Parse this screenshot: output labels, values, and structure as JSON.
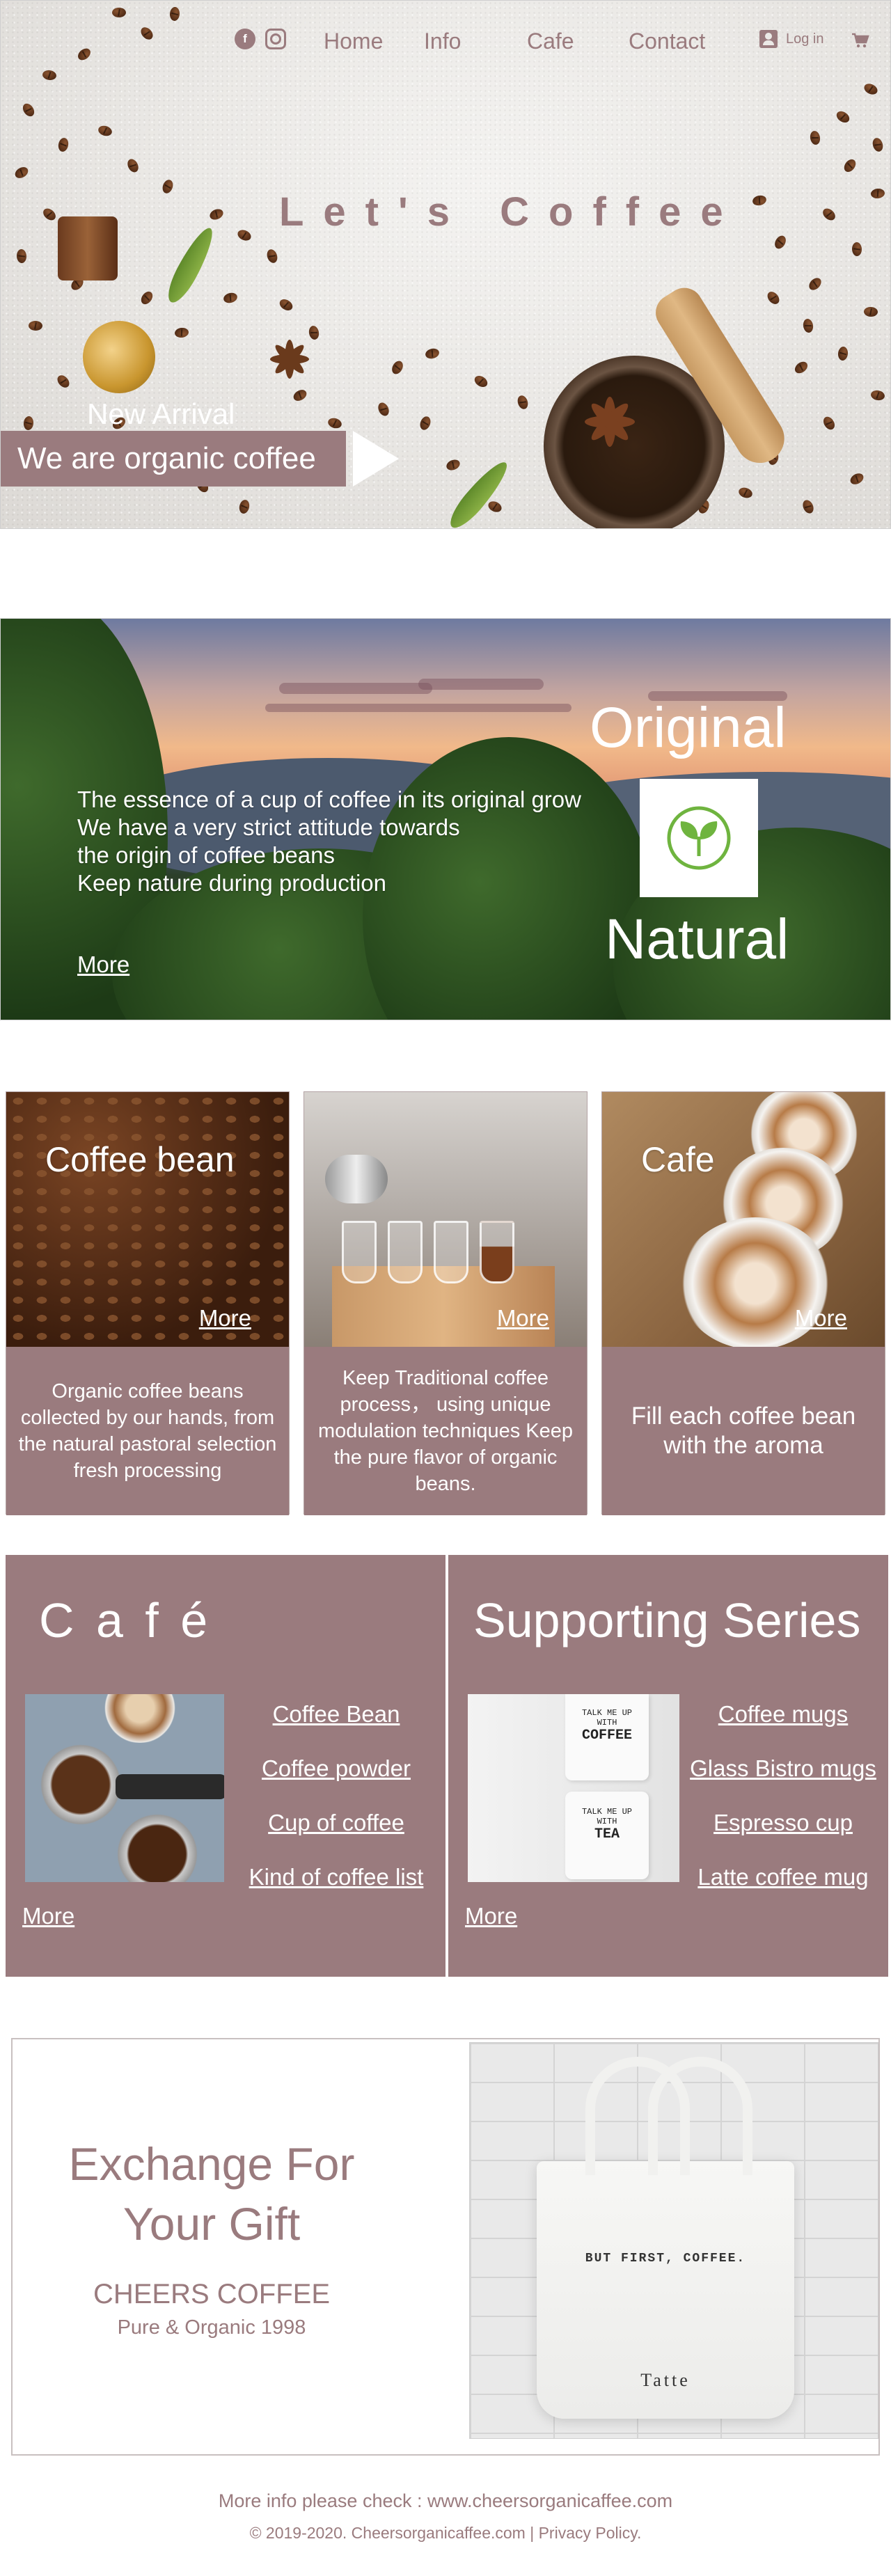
{
  "colors": {
    "accent": "#9a7b7e",
    "white": "#ffffff"
  },
  "nav": {
    "social": [
      {
        "icon": "facebook-icon",
        "glyph": "f"
      },
      {
        "icon": "instagram-icon",
        "glyph": ""
      }
    ],
    "links": [
      "Home",
      "Info",
      "Cafe",
      "Contact"
    ],
    "login_label": "Log in",
    "cart_icon": "cart-icon"
  },
  "hero": {
    "title": "Let's Coffee",
    "new_arrival": "New Arrival",
    "tagline": "We are organic coffee"
  },
  "nature": {
    "lines": [
      "The essence of a cup of coffee in its original grow",
      "We have a very strict attitude towards",
      "the origin of coffee beans",
      "Keep nature during production"
    ],
    "more_label": "More",
    "original": "Original",
    "natural": "Natural",
    "badge_icon": "sprout-leaf-icon"
  },
  "cards": [
    {
      "title": "Coffee bean",
      "more": "More",
      "body": "Organic coffee beans collected by our hands, from the natural pastoral selection fresh processing"
    },
    {
      "title": "",
      "more": "More",
      "body": "Keep Traditional coffee process， using unique modulation techniques Keep the pure flavor of organic beans."
    },
    {
      "title": "Cafe",
      "more": "More",
      "body": "Fill each coffee bean with the aroma"
    }
  ],
  "cafe_panel": {
    "title": "C a f é",
    "links": [
      "Coffee Bean",
      "Coffee powder",
      "Cup of coffee",
      "Kind of coffee list"
    ],
    "more_label": "More"
  },
  "series_panel": {
    "title": "Supporting  Series",
    "links": [
      "Coffee mugs",
      "Glass Bistro mugs",
      "Espresso cup",
      "Latte coffee mug"
    ],
    "more_label": "More",
    "mug_text_1": [
      "TALK ME UP",
      "WITH",
      "COFFEE"
    ],
    "mug_text_2": [
      "TALK ME UP",
      "WITH",
      "TEA"
    ]
  },
  "gift": {
    "title_line1": "Exchange  For",
    "title_line2": "Your   Gift",
    "brand": "CHEERS COFFEE",
    "sub": "Pure & Organic  1998",
    "bag_text": "BUT FIRST, COFFEE.",
    "bag_brand": "Tatte"
  },
  "footer": {
    "info": "More info please check : www.cheersorganicaffee.com",
    "copyright": "© 2019-2020. Cheersorganicaffee.com | Privacy Policy."
  }
}
